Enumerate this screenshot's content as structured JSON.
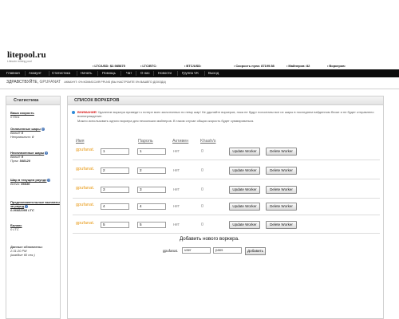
{
  "site": {
    "logo": "litepool.ru",
    "tagline": "Litecoin mining pool"
  },
  "stats_bar": [
    {
      "label": "LTC/USD:",
      "value": "$2.985875"
    },
    {
      "label": "LTC/BTC:",
      "value": ""
    },
    {
      "label": "BTC/USD:",
      "value": ""
    },
    {
      "label": "Скорость пула:",
      "value": "87199.58"
    },
    {
      "label": "Майнеров:",
      "value": "82"
    },
    {
      "label": "Воркеров:",
      "value": ""
    }
  ],
  "nav": [
    "Главная",
    "Аккаунт",
    "Статистика",
    "Начать",
    "Помощь",
    "Чат",
    "О нас",
    "Новости",
    "Группа VK",
    "Выход"
  ],
  "welcome": {
    "greeting": "ЗДРАВСТВУЙТЕ,",
    "username": "GPUFANAT",
    "account_note": "АККАУНТ: 0% КОМИССИЯ PPLNS (ВЫ НАСТРОИТЕ 0% ВАШЕГО ДОХОДА)"
  },
  "sidebar": {
    "title": "Статистика",
    "hashrate": {
      "title": "Ваша скорость",
      "value": "0 Kh/s"
    },
    "valid_shares": {
      "title": "Оплаченные шары",
      "valid_label": "Валид:",
      "valid_value": "0",
      "invalid_label": "Неправильно:",
      "invalid_value": "0"
    },
    "unpaid_shares": {
      "title": "Неоплаченные шары",
      "valid_label": "Валид:",
      "valid_value": "9",
      "pool_label": "Пула:",
      "pool_value": "548120"
    },
    "round_shares": {
      "title": "Шар в текущем раунде",
      "label": "Всего:",
      "value": "56636"
    },
    "estimate": {
      "title": "Предположительные выплаты за раунд",
      "value": "0.06682095 LTC"
    },
    "balance": {
      "title": "Баланс",
      "value": "0 LTC"
    },
    "last_update": {
      "title": "Данные обновлены:",
      "line1": "2:31:20 PM",
      "line2": "(каждые 60 сек.)"
    }
  },
  "main": {
    "title": "СПИСОК ВОРКЕРОВ",
    "warning_label": "ВНИМАНИЕ!",
    "warning_text": "Удаление воркера приведет к потере всех засчитанных по нему шар! Не удаляйте воркеров, пока не будут посчитаны все их шары в последнем найденном блоке и не будет отправлено вознаграждение.",
    "warning_text2": "Можно использовать одного воркера для нескольких майнеров. В таком случае общая скорость будет суммироваться.",
    "columns": [
      "Имя",
      "Пароль",
      "Активен",
      "Khash/s"
    ],
    "workers": [
      {
        "prefix": "gpufanat.",
        "name": "1",
        "password": "1",
        "active": "нет",
        "hashrate": "0"
      },
      {
        "prefix": "gpufanat.",
        "name": "2",
        "password": "2",
        "active": "нет",
        "hashrate": "0"
      },
      {
        "prefix": "gpufanat.",
        "name": "3",
        "password": "3",
        "active": "нет",
        "hashrate": "0"
      },
      {
        "prefix": "gpufanat.",
        "name": "4",
        "password": "4",
        "active": "нет",
        "hashrate": "0"
      },
      {
        "prefix": "gpufanat.",
        "name": "5",
        "password": "5",
        "active": "нет",
        "hashrate": "0"
      }
    ],
    "update_label": "Update Worker",
    "delete_label": "Delete Worker",
    "add": {
      "title": "Добавить нового воркера.",
      "prefix": "gpufanat.",
      "user_value": "user",
      "pass_value": "pass",
      "button": "Добавить"
    }
  }
}
